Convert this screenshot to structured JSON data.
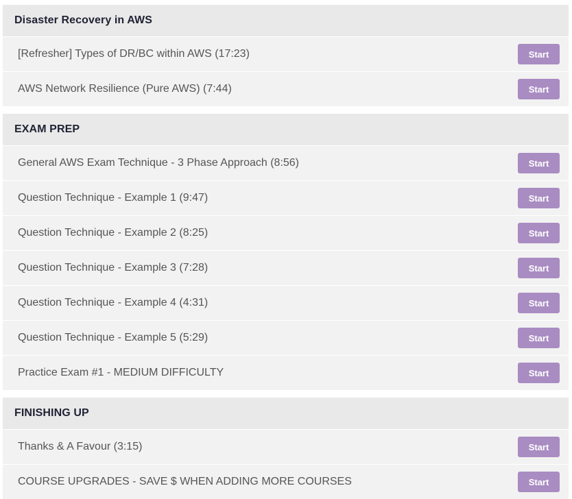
{
  "sections": [
    {
      "title": "Disaster Recovery in AWS",
      "lectures": [
        {
          "title": "[Refresher] Types of DR/BC within AWS (17:23)",
          "button": "Start"
        },
        {
          "title": "AWS Network Resilience (Pure AWS) (7:44)",
          "button": "Start"
        }
      ]
    },
    {
      "title": "EXAM PREP",
      "lectures": [
        {
          "title": "General AWS Exam Technique - 3 Phase Approach (8:56)",
          "button": "Start"
        },
        {
          "title": "Question Technique - Example 1 (9:47)",
          "button": "Start"
        },
        {
          "title": "Question Technique - Example 2 (8:25)",
          "button": "Start"
        },
        {
          "title": "Question Technique - Example 3 (7:28)",
          "button": "Start"
        },
        {
          "title": "Question Technique - Example 4 (4:31)",
          "button": "Start"
        },
        {
          "title": "Question Technique - Example 5 (5:29)",
          "button": "Start"
        },
        {
          "title": "Practice Exam #1 - MEDIUM DIFFICULTY",
          "button": "Start"
        }
      ]
    },
    {
      "title": "FINISHING UP",
      "lectures": [
        {
          "title": "Thanks & A Favour (3:15)",
          "button": "Start"
        },
        {
          "title": "COURSE UPGRADES - SAVE $ WHEN ADDING MORE COURSES",
          "button": "Start"
        }
      ]
    }
  ],
  "colors": {
    "section_header_bg": "#e9e9e9",
    "row_bg": "#f2f2f2",
    "button_bg": "#a98cc2",
    "header_text": "#1f2233",
    "row_text": "#555555"
  }
}
